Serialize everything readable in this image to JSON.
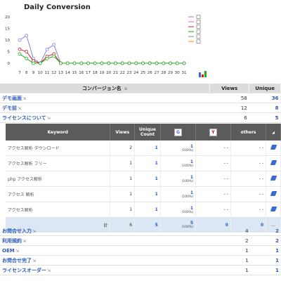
{
  "chart": {
    "title": "Daily Conversion",
    "legend_items": 6,
    "chart_data": {
      "type": "line",
      "title": "Daily Conversion",
      "x": [
        7,
        8,
        9,
        10,
        11,
        12,
        13,
        14,
        15,
        16,
        17,
        18,
        19,
        20,
        21,
        22,
        23,
        24,
        25,
        26,
        27,
        28,
        29,
        30,
        31
      ],
      "yticks": [
        0,
        5,
        10,
        15,
        20
      ],
      "ylim": [
        0,
        20
      ],
      "series": [
        {
          "color": "#8080e0",
          "values": [
            10,
            12,
            2,
            0,
            6,
            8,
            0,
            0,
            0,
            0,
            0,
            0,
            0,
            0,
            0,
            0,
            0,
            0,
            0,
            0,
            0,
            0,
            0,
            0,
            0
          ]
        },
        {
          "color": "#cc2222",
          "values": [
            6,
            5,
            1,
            0,
            3,
            4,
            0,
            0,
            0,
            0,
            0,
            0,
            0,
            0,
            0,
            0,
            0,
            0,
            0,
            0,
            0,
            0,
            0,
            0,
            0
          ]
        },
        {
          "color": "#22aa22",
          "values": [
            4,
            2,
            0,
            0,
            2,
            3,
            0,
            0,
            0,
            0,
            0,
            0,
            0,
            0,
            0,
            0,
            0,
            0,
            0,
            0,
            0,
            0,
            0,
            0,
            0
          ]
        }
      ]
    }
  },
  "main": {
    "headers": [
      "コンバージョン名",
      "Views",
      "Unique"
    ],
    "rows": [
      {
        "name": "デモ画面",
        "views": "58",
        "unique": "36"
      },
      {
        "name": "デモ前",
        "views": "12",
        "unique": "8"
      },
      {
        "name": "ライセンスについて",
        "views": "6",
        "unique": "5"
      }
    ]
  },
  "keywords": {
    "headers": {
      "keyword": "Keyword",
      "views": "Views",
      "unique": "Unique Count",
      "google": "G",
      "yahoo": "Y",
      "others": "others"
    },
    "rows": [
      {
        "keyword": "アクセス解析 ダウンロード",
        "views": "2",
        "unique": "1",
        "google": "1",
        "google_pct": "(100%)",
        "yahoo": "- -",
        "others": "- -"
      },
      {
        "keyword": "アクセス解析 フリー",
        "views": "1",
        "unique": "1",
        "google": "1",
        "google_pct": "(100%)",
        "yahoo": "- -",
        "others": "- -"
      },
      {
        "keyword": "php アクセス解析",
        "views": "1",
        "unique": "1",
        "google": "1",
        "google_pct": "(100%)",
        "yahoo": "- -",
        "others": "- -"
      },
      {
        "keyword": "アクセス 解析",
        "views": "1",
        "unique": "1",
        "google": "1",
        "google_pct": "(100%)",
        "yahoo": "- -",
        "others": "- -"
      },
      {
        "keyword": "アクセス解析",
        "views": "1",
        "unique": "1",
        "google": "1",
        "google_pct": "(100%)",
        "yahoo": "- -",
        "others": "- -"
      }
    ],
    "total": {
      "label": "計",
      "views": "6",
      "unique": "5",
      "google": "5",
      "google_pct": "(100%)",
      "yahoo": "0",
      "others": "0",
      "end": "..."
    }
  },
  "bottom": {
    "rows": [
      {
        "name": "お問合せ入力",
        "views": "4",
        "unique": "2"
      },
      {
        "name": "利用規約",
        "views": "2",
        "unique": "2"
      },
      {
        "name": "OEM",
        "views": "1",
        "unique": "1"
      },
      {
        "name": "お問合せ完了",
        "views": "1",
        "unique": "1"
      },
      {
        "name": "ライセンスオーダー",
        "views": "1",
        "unique": "1"
      }
    ]
  }
}
